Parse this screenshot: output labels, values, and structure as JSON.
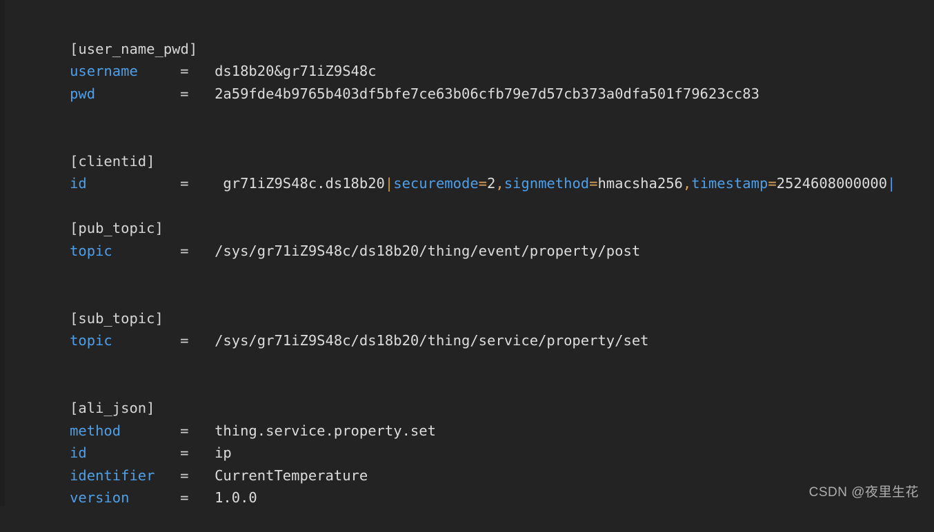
{
  "editor": {
    "background_color": "#232323",
    "default_text_color": "#d8d8d8",
    "key_color": "#4f9fe8",
    "section_color": "#d6d6d6",
    "punct_color": "#d9a05b",
    "pipe_color": "#c9a227",
    "file_type": "ini"
  },
  "sections": [
    {
      "header": "[user_name_pwd]",
      "entries": [
        {
          "key": "username",
          "eq": "=",
          "value": "ds18b20&gr71iZ9S48c"
        },
        {
          "key": "pwd",
          "eq": "=",
          "value": "2a59fde4b9765b403df5bfe7ce63b06cfb79e7d57cb373a0dfa501f79623cc83"
        }
      ]
    },
    {
      "header": "[clientid]",
      "entries": [
        {
          "key": "id",
          "eq": "=",
          "value_prefix": " gr71iZ9S48c.ds18b20",
          "pipe": "|",
          "pairs": [
            {
              "name": "securemode",
              "assign": "=",
              "val": "2",
              "sep": ","
            },
            {
              "name": "signmethod",
              "assign": "=",
              "val": "hmacsha256",
              "sep": ","
            },
            {
              "name": "timestamp",
              "assign": "=",
              "val": "2524608000000",
              "sep": ""
            }
          ],
          "trailing_pipe": "|"
        }
      ]
    },
    {
      "header": "[pub_topic]",
      "entries": [
        {
          "key": "topic",
          "eq": "=",
          "value": "/sys/gr71iZ9S48c/ds18b20/thing/event/property/post"
        }
      ]
    },
    {
      "header": "[sub_topic]",
      "entries": [
        {
          "key": "topic",
          "eq": "=",
          "value": "/sys/gr71iZ9S48c/ds18b20/thing/service/property/set"
        }
      ]
    },
    {
      "header": "[ali_json]",
      "entries": [
        {
          "key": "method",
          "eq": "=",
          "value": "thing.service.property.set"
        },
        {
          "key": "id",
          "eq": "=",
          "value": "ip"
        },
        {
          "key": "identifier",
          "eq": "=",
          "value": "CurrentTemperature"
        },
        {
          "key": "version",
          "eq": "=",
          "value": "1.0.0"
        }
      ]
    }
  ],
  "watermark": {
    "text": "CSDN @夜里生花"
  }
}
